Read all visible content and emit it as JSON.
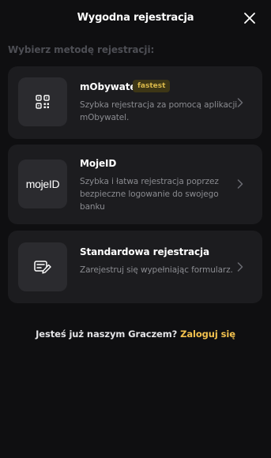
{
  "header": {
    "title": "Wygodna rejestracja"
  },
  "section": {
    "heading": "Wybierz metodę rejestracji:"
  },
  "methods": [
    {
      "title": "mObywatel",
      "badge": "fastest",
      "description": "Szybka rejestracja za pomocą aplikacji mObywatel.",
      "icon": "qr-code-icon"
    },
    {
      "title": "MojeID",
      "description": "Szybka i łatwa rejestracja poprzez bezpieczne logowanie do swojego banku",
      "logo_text": "mojeID",
      "icon": "mojeid-logo"
    },
    {
      "title": "Standardowa rejestracja",
      "description": "Zarejestruj się wypełniając formularz.",
      "icon": "form-edit-icon"
    }
  ],
  "footer": {
    "text": "Jesteś już naszym Graczem?",
    "link": "Zaloguj się"
  },
  "colors": {
    "background": "#0f0f11",
    "card": "#1c1c1f",
    "icon_box": "#2b2b2f",
    "muted_text": "#8a8b90",
    "accent": "#f2c14e",
    "badge_text": "#d9b84a",
    "badge_bg": "#3d3616"
  }
}
